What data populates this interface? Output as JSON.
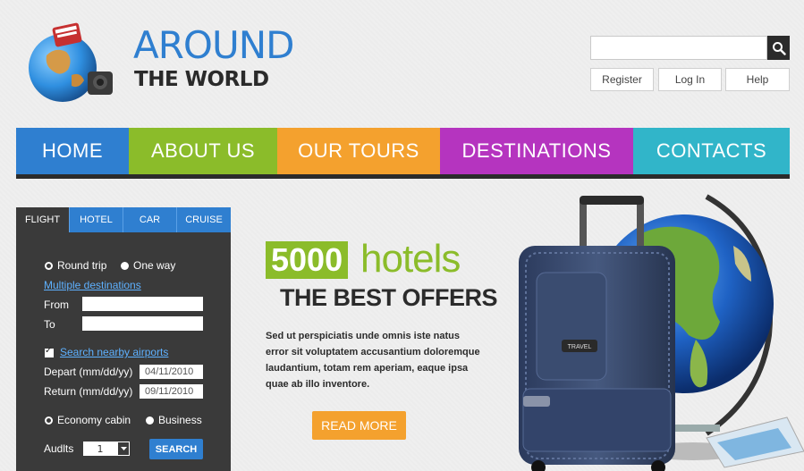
{
  "brand": {
    "title_line1": "AROUND",
    "title_line2": "THE WORLD"
  },
  "header": {
    "search_placeholder": "",
    "links": [
      "Register",
      "Log In",
      "Help"
    ]
  },
  "nav": {
    "items": [
      {
        "label": "HOME",
        "color": "#2f7fd0"
      },
      {
        "label": "ABOUT US",
        "color": "#8bbc2a"
      },
      {
        "label": "OUR TOURS",
        "color": "#f4a12e"
      },
      {
        "label": "DESTINATIONS",
        "color": "#b534bf"
      },
      {
        "label": "CONTACTS",
        "color": "#31b5c9"
      }
    ]
  },
  "booking": {
    "tabs": [
      "FLIGHT",
      "HOTEL",
      "CAR",
      "CRUISE"
    ],
    "active_tab": "FLIGHT",
    "trip_types": [
      "Round trip",
      "One way"
    ],
    "selected_trip_type": "Round trip",
    "multiple_destinations_link": "Multiple destinations",
    "from_label": "From",
    "to_label": "To",
    "from_value": "",
    "to_value": "",
    "nearby_airports_label": "Search nearby airports",
    "nearby_airports_checked": true,
    "depart_label": "Depart (mm/dd/yy)",
    "depart_value": "04/11/2010",
    "return_label": "Return (mm/dd/yy)",
    "return_value": "09/11/2010",
    "cabins": [
      "Economy cabin",
      "Business"
    ],
    "selected_cabin": "Economy cabin",
    "adults_label": "Audlts",
    "adults_value": "1",
    "search_button": "SEARCH"
  },
  "promo": {
    "number": "5000",
    "word": "hotels",
    "title": "THE BEST OFFERS",
    "body": "Sed ut perspiciatis unde omnis iste natus error sit voluptatem accusantium doloremque laudantium, totam rem aperiam, eaque ipsa quae ab illo inventore.",
    "button": "READ MORE",
    "suitcase_tag": "TRAVEL"
  }
}
